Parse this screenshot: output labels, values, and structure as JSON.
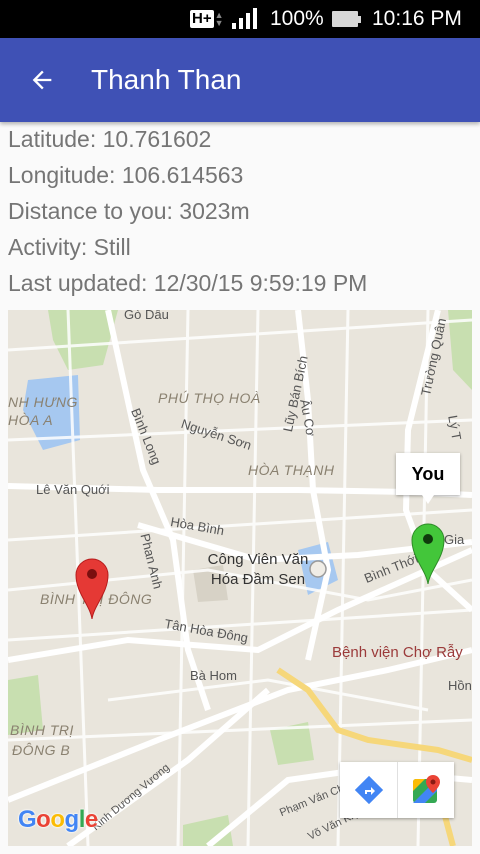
{
  "status_bar": {
    "network": "H+",
    "battery_percent": "100%",
    "time": "10:16 PM"
  },
  "app_bar": {
    "title": "Thanh Than",
    "back_icon": "arrow-back-icon"
  },
  "details": {
    "latitude": "Latitude: 10.761602",
    "longitude": "Longitude: 106.614563",
    "distance": "Distance to you: 3023m",
    "activity": "Activity: Still",
    "last_updated": "Last updated: 12/30/15 9:59:19 PM"
  },
  "map": {
    "you_label": "You",
    "labels": {
      "go_dau": "Gò Dầu",
      "phu_tho_hoa": "PHÚ THỌ HOÀ",
      "luy_ban_bich": "Lũy Bán Bích",
      "au_co": "Âu Cơ",
      "binh_hung_hoa_a_1": "NH HƯNG",
      "binh_hung_hoa_a_2": "HÒA A",
      "binh_long": "Bình Long",
      "nguyen_son": "Nguyễn Sơn",
      "hoa_thanh": "HÒA THẠNH",
      "truong_chinh_quan": "Trường Quân",
      "ly_thuong_kiet": "Lý T",
      "le_van_quoi": "Lê Văn Quới",
      "hoa_binh": "Hòa Bình",
      "phan_anh": "Phan Anh",
      "cong_vien_1": "Công Viên Văn",
      "cong_vien_2": "Hóa Đầm Sen",
      "binh_thoi": "Bình Thới",
      "gia": "Gia",
      "binh_tri_dong_top": "BÌNH TRỊ ĐÔNG",
      "tan_hoa_dong": "Tân Hòa Đông",
      "benh_vien": "Bệnh viện Chợ Rẫy",
      "ba_hom": "Bà Hom",
      "hong": "Hồng",
      "binh_tri_dong_b_1": "BÌNH TRỊ",
      "binh_tri_dong_b_2": "ĐÔNG B",
      "kinh_duong_vuong": "Kinh Dương Vương",
      "pham_van_chi": "Phạm Văn Chí",
      "vo_van_kiet": "Võ Văn Kiệt"
    },
    "tools": {
      "directions_icon": "directions-icon",
      "maps_icon": "google-maps-icon"
    },
    "logo": [
      "G",
      "o",
      "o",
      "g",
      "l",
      "e"
    ],
    "colors": {
      "app_bar": "#3f51b5",
      "red_pin": "#e53935",
      "green_pin": "#43c63a"
    }
  }
}
